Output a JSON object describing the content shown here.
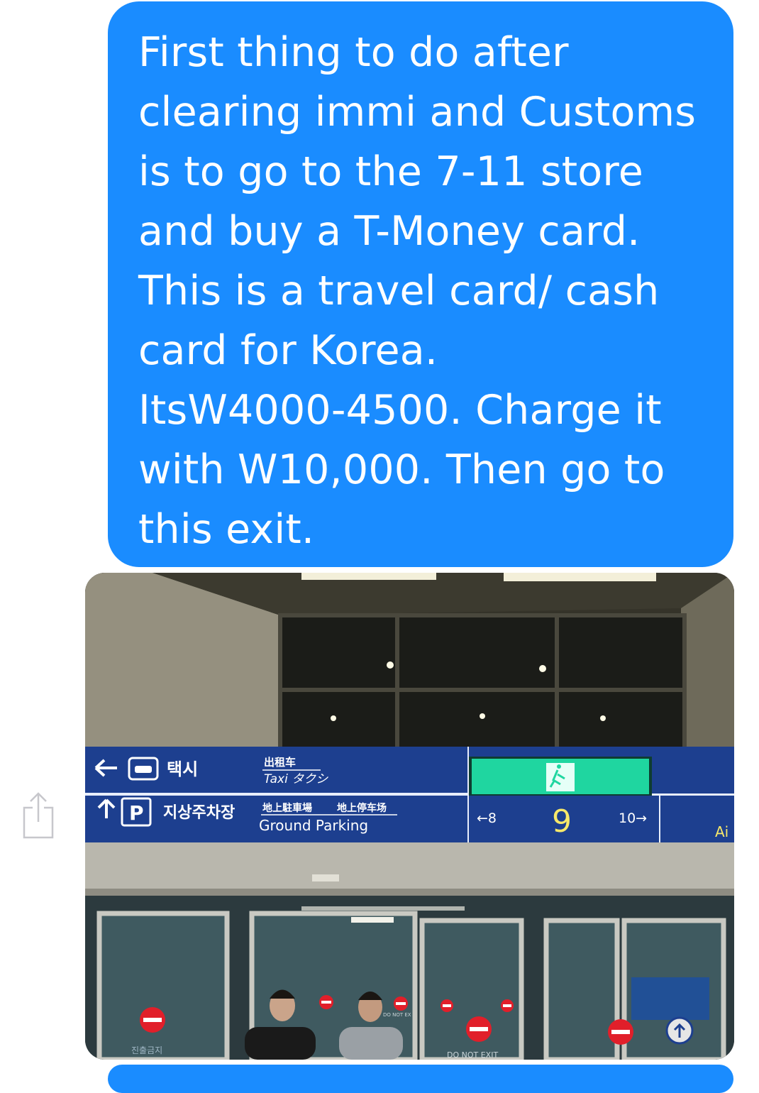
{
  "message": {
    "text": "First thing to do after\nclearing immi and Customs\nis to go to the 7-11 store\nand buy a T-Money card.\nThis is a travel card/ cash\ncard for Korea.\nItsW4000-4500. Charge it\nwith W10,000. Then go to\nthis exit."
  },
  "share": {
    "icon": "share-icon"
  },
  "photo": {
    "sign_taxi_kr": "택시",
    "sign_taxi_cn": "出租车",
    "sign_taxi_jp": "Taxi タクシ",
    "sign_parking_kr": "지상주차장",
    "sign_parking_jp": "地上駐車場",
    "sign_parking_cn": "地上停车场",
    "sign_parking_en": "Ground Parking",
    "sign_gate_left": "←8",
    "sign_gate_number": "9",
    "sign_gate_right": "10→",
    "sign_airport": "Ai",
    "door_no_entry": "진출금지",
    "door_do_not_exit": "DO NOT EXIT",
    "door_do_not_exit_small": "DO NOT EX",
    "colors": {
      "bubble": "#1a8cff",
      "sign_blue": "#1d3f8f",
      "exit_green": "#1fd6a0"
    }
  }
}
